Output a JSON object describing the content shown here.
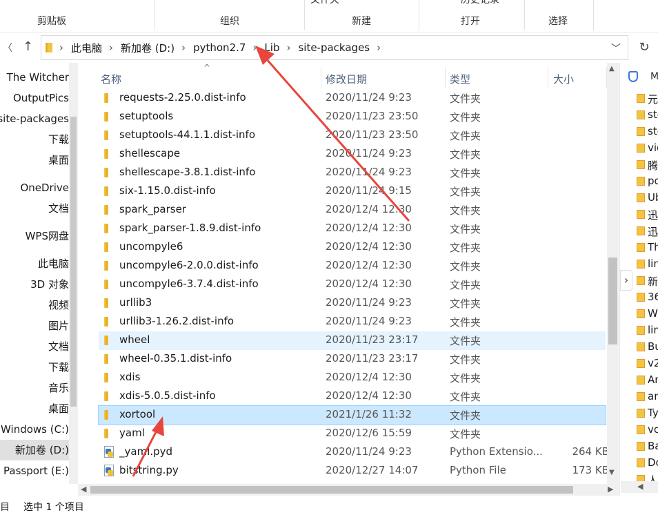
{
  "ribbon": {
    "cut_top_1": "文件夹",
    "cut_top_2": "历史记录",
    "groups": [
      "剪贴板",
      "组织",
      "新建",
      "打开",
      "选择"
    ]
  },
  "address": {
    "crumbs": [
      "此电脑",
      "新加卷 (D:)",
      "python2.7",
      "Lib",
      "site-packages"
    ]
  },
  "nav": {
    "items": [
      "The Witcher",
      "OutputPics",
      "site-packages",
      "下载",
      "桌面",
      "OneDrive",
      "文档",
      "WPS网盘",
      "此电脑",
      "3D 对象",
      "视频",
      "图片",
      "文档",
      "下载",
      "音乐",
      "桌面",
      "Windows (C:)",
      "新加卷 (D:)",
      "My Passport (E:)",
      "My Passport (E:)"
    ]
  },
  "columns": {
    "name": "名称",
    "date": "修改日期",
    "type": "类型",
    "size": "大小"
  },
  "files": [
    {
      "name": "requests-2.25.0.dist-info",
      "date": "2020/11/24 9:23",
      "type": "文件夹",
      "size": "",
      "kind": "folder",
      "state": ""
    },
    {
      "name": "setuptools",
      "date": "2020/11/23 23:50",
      "type": "文件夹",
      "size": "",
      "kind": "folder",
      "state": ""
    },
    {
      "name": "setuptools-44.1.1.dist-info",
      "date": "2020/11/23 23:50",
      "type": "文件夹",
      "size": "",
      "kind": "folder",
      "state": ""
    },
    {
      "name": "shellescape",
      "date": "2020/11/24 9:23",
      "type": "文件夹",
      "size": "",
      "kind": "folder",
      "state": ""
    },
    {
      "name": "shellescape-3.8.1.dist-info",
      "date": "2020/11/24 9:23",
      "type": "文件夹",
      "size": "",
      "kind": "folder",
      "state": ""
    },
    {
      "name": "six-1.15.0.dist-info",
      "date": "2020/11/24 9:15",
      "type": "文件夹",
      "size": "",
      "kind": "folder",
      "state": ""
    },
    {
      "name": "spark_parser",
      "date": "2020/12/4 12:30",
      "type": "文件夹",
      "size": "",
      "kind": "folder",
      "state": ""
    },
    {
      "name": "spark_parser-1.8.9.dist-info",
      "date": "2020/12/4 12:30",
      "type": "文件夹",
      "size": "",
      "kind": "folder",
      "state": ""
    },
    {
      "name": "uncompyle6",
      "date": "2020/12/4 12:30",
      "type": "文件夹",
      "size": "",
      "kind": "folder",
      "state": ""
    },
    {
      "name": "uncompyle6-2.0.0.dist-info",
      "date": "2020/12/4 12:30",
      "type": "文件夹",
      "size": "",
      "kind": "folder",
      "state": ""
    },
    {
      "name": "uncompyle6-3.7.4.dist-info",
      "date": "2020/12/4 12:30",
      "type": "文件夹",
      "size": "",
      "kind": "folder",
      "state": ""
    },
    {
      "name": "urllib3",
      "date": "2020/11/24 9:23",
      "type": "文件夹",
      "size": "",
      "kind": "folder",
      "state": ""
    },
    {
      "name": "urllib3-1.26.2.dist-info",
      "date": "2020/11/24 9:23",
      "type": "文件夹",
      "size": "",
      "kind": "folder",
      "state": ""
    },
    {
      "name": "wheel",
      "date": "2020/11/23 23:17",
      "type": "文件夹",
      "size": "",
      "kind": "folder",
      "state": "hover"
    },
    {
      "name": "wheel-0.35.1.dist-info",
      "date": "2020/11/23 23:17",
      "type": "文件夹",
      "size": "",
      "kind": "folder",
      "state": ""
    },
    {
      "name": "xdis",
      "date": "2020/12/4 12:30",
      "type": "文件夹",
      "size": "",
      "kind": "folder",
      "state": ""
    },
    {
      "name": "xdis-5.0.5.dist-info",
      "date": "2020/12/4 12:30",
      "type": "文件夹",
      "size": "",
      "kind": "folder",
      "state": ""
    },
    {
      "name": "xortool",
      "date": "2021/1/26 11:32",
      "type": "文件夹",
      "size": "",
      "kind": "folder",
      "state": "sel"
    },
    {
      "name": "yaml",
      "date": "2020/12/6 15:59",
      "type": "文件夹",
      "size": "",
      "kind": "folder",
      "state": ""
    },
    {
      "name": "_yaml.pyd",
      "date": "2020/11/24 9:23",
      "type": "Python Extensio...",
      "size": "264 KB",
      "kind": "file",
      "state": ""
    },
    {
      "name": "bitstring.py",
      "date": "2020/12/27 14:07",
      "type": "Python File",
      "size": "173 KB",
      "kind": "file",
      "state": ""
    }
  ],
  "right_pane": {
    "header": "M",
    "items": [
      "元",
      "ste",
      "ste",
      "vid",
      "腾",
      "po",
      "Ub",
      "迅",
      "迅",
      "Th",
      "lin",
      "新",
      "36",
      "W",
      "lin",
      "Bu",
      "v2",
      "An",
      "an",
      "Ty",
      "vc",
      "Ba",
      "Do",
      "人"
    ]
  },
  "status": {
    "count": "目",
    "selected": "选中 1 个项目"
  },
  "colors": {
    "selected": "#cce8ff",
    "hover": "#e5f3ff",
    "arrow": "#e8453c",
    "folder": "#f5c342"
  }
}
